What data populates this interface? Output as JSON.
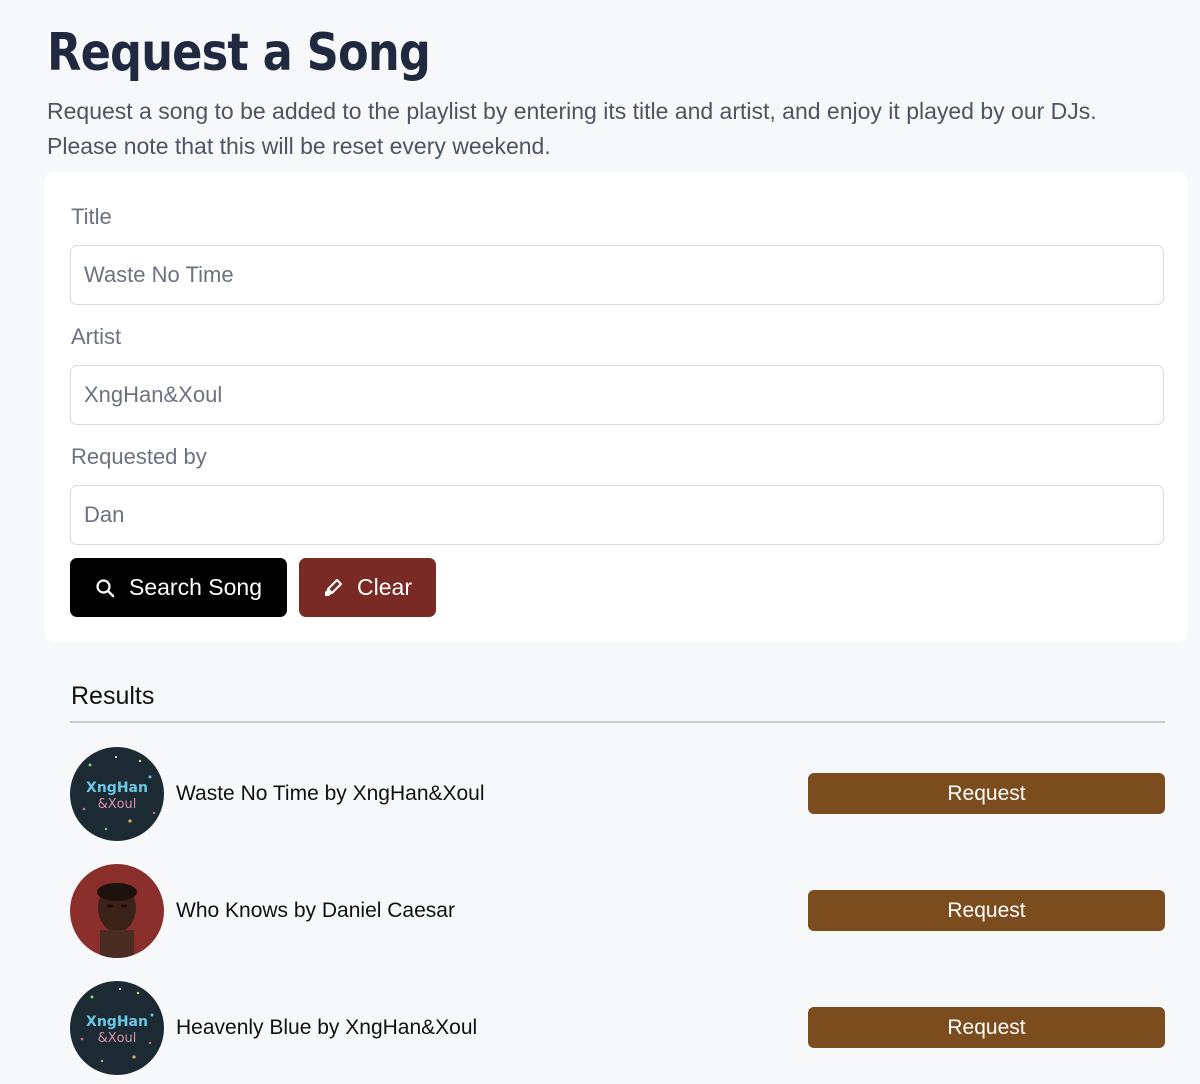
{
  "header": {
    "title": "Request a Song",
    "description": "Request a song to be added to the playlist by entering its title and artist, and enjoy it played by our DJs. Please note that this will be reset every weekend."
  },
  "form": {
    "title_label": "Title",
    "title_value": "Waste No Time",
    "artist_label": "Artist",
    "artist_value": "XngHan&Xoul",
    "requested_by_label": "Requested by",
    "requested_by_value": "Dan",
    "search_button_label": "Search Song",
    "search_button_icon": "search-icon",
    "clear_button_label": "Clear",
    "clear_button_icon": "eraser-icon"
  },
  "results": {
    "heading": "Results",
    "items": [
      {
        "text": "Waste No Time by XngHan&Xoul",
        "button_label": "Request",
        "cover_line1": "XngHan",
        "cover_line2": "&Xoul"
      },
      {
        "text": "Who Knows by Daniel Caesar",
        "button_label": "Request"
      },
      {
        "text": "Heavenly Blue by XngHan&Xoul",
        "button_label": "Request",
        "cover_line1": "XngHan",
        "cover_line2": "&Xoul"
      }
    ]
  },
  "colors": {
    "title": "#1f2a40",
    "search_button": "#000000",
    "clear_button": "#7a2a25",
    "request_button": "#7b4c1d",
    "cover_portrait_bg": "#8b2f2c"
  }
}
